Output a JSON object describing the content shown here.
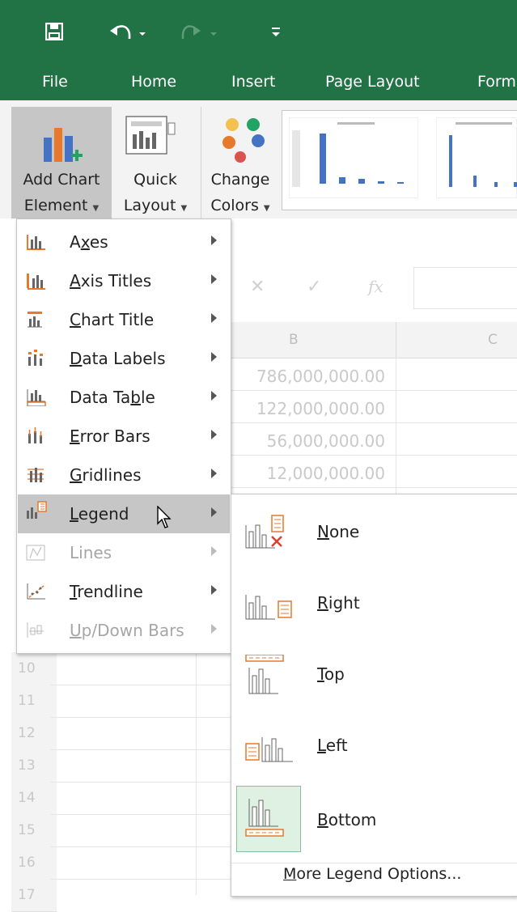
{
  "tabs": [
    "File",
    "Home",
    "Insert",
    "Page Layout",
    "Form"
  ],
  "ribbon": {
    "add_chart": {
      "line1": "Add Chart",
      "line2": "Element"
    },
    "quick_layout": {
      "line1": "Quick",
      "line2": "Layout"
    },
    "change_colors": {
      "line1": "Change",
      "line2": "Colors"
    }
  },
  "sheet": {
    "col_b": "B",
    "col_c": "C",
    "values": [
      "786,000,000.00",
      "122,000,000.00",
      "56,000,000.00",
      "12,000,000.00"
    ],
    "rows": [
      "10",
      "11",
      "12",
      "13",
      "14",
      "15",
      "16",
      "17"
    ]
  },
  "menu": {
    "items": [
      {
        "label": "Axes",
        "ul": "x",
        "disabled": false
      },
      {
        "label": "Axis Titles",
        "ul": "A",
        "disabled": false
      },
      {
        "label": "Chart Title",
        "ul": "C",
        "disabled": false
      },
      {
        "label": "Data Labels",
        "ul": "D",
        "disabled": false
      },
      {
        "label": "Data Table",
        "ul": "b",
        "disabled": false
      },
      {
        "label": "Error Bars",
        "ul": "E",
        "disabled": false
      },
      {
        "label": "Gridlines",
        "ul": "G",
        "disabled": false
      },
      {
        "label": "Legend",
        "ul": "L",
        "disabled": false
      },
      {
        "label": "Lines",
        "ul": "I",
        "disabled": true
      },
      {
        "label": "Trendline",
        "ul": "T",
        "disabled": false
      },
      {
        "label": "Up/Down Bars",
        "ul": "U",
        "disabled": true
      }
    ]
  },
  "submenu": {
    "items": [
      {
        "label": "None",
        "ul": "N"
      },
      {
        "label": "Right",
        "ul": "R"
      },
      {
        "label": "Top",
        "ul": "T"
      },
      {
        "label": "Left",
        "ul": "L"
      },
      {
        "label": "Bottom",
        "ul": "B"
      }
    ],
    "more": "More Legend Options..."
  },
  "colors": {
    "brand": "#217346",
    "accent_orange": "#e8782a",
    "accent_blue": "#4472c4",
    "select_green": "#dff1e3"
  }
}
